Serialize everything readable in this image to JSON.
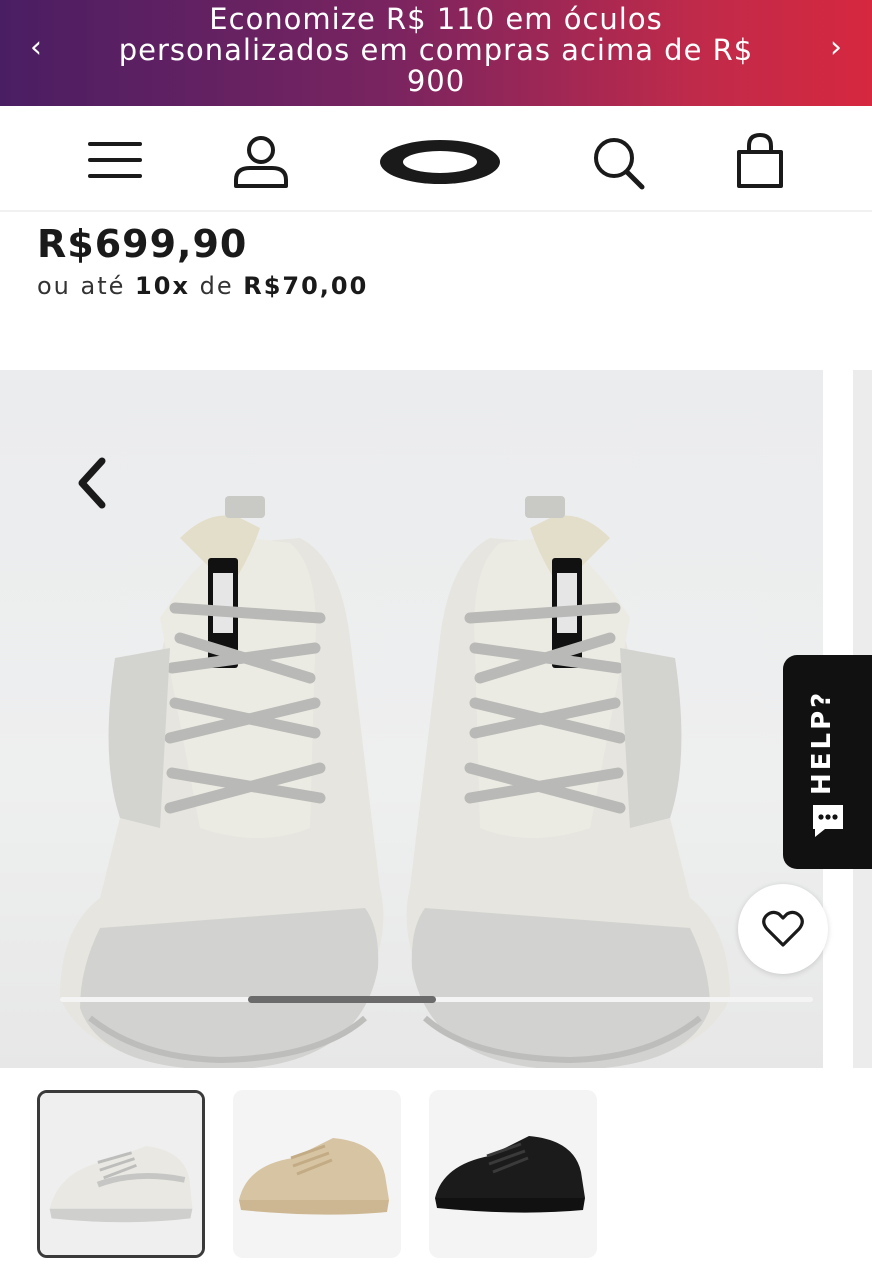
{
  "promo": {
    "text": "Economize R$ 110 em óculos personalizados em compras acima de R$ 900",
    "prev_glyph": "‹",
    "next_glyph": "›"
  },
  "header": {
    "icons": [
      "menu-icon",
      "account-icon",
      "oakley-logo",
      "search-icon",
      "bag-icon"
    ]
  },
  "product": {
    "price": "R$699,90",
    "installments_prefix": "ou até",
    "installments_count": "10x",
    "installments_mid": "de",
    "installments_value": "R$70,00"
  },
  "gallery": {
    "prev_glyph": "‹",
    "scroll_position": 0.25
  },
  "help": {
    "label": "HELP?"
  },
  "thumbnails": [
    {
      "label": "white",
      "color": "#e9e8e3",
      "selected": true
    },
    {
      "label": "sand",
      "color": "#d7c4a2",
      "selected": false
    },
    {
      "label": "black",
      "color": "#1b1b1b",
      "selected": false
    }
  ],
  "colors": {
    "promo_start": "#4a1e63",
    "promo_end": "#d6283f",
    "help_bg": "#111111"
  }
}
